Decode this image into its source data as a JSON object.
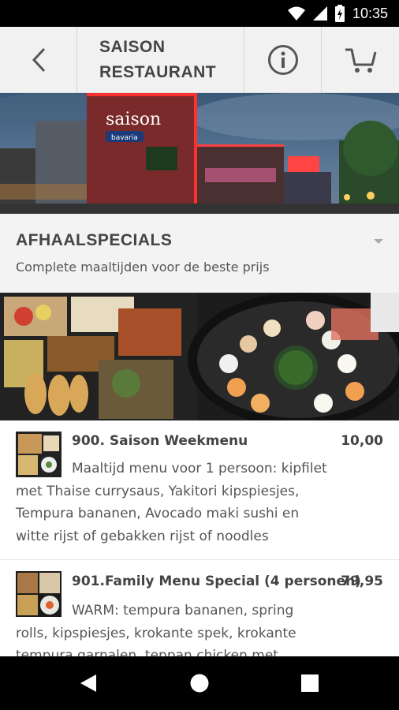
{
  "status_bar": {
    "time": "10:35",
    "icons": [
      "wifi-icon",
      "signal-icon",
      "battery-charging-icon"
    ]
  },
  "header": {
    "title_line1": "SAISON",
    "title_line2": "RESTAURANT",
    "icons": [
      "back-arrow-icon",
      "info-icon",
      "cart-icon"
    ]
  },
  "banner": {
    "sign_text": "saison",
    "sub_sign_text": "bavaria"
  },
  "category": {
    "title": "AFHAALSPECIALS",
    "subtitle": "Complete maaltijden voor de beste prijs"
  },
  "menu": {
    "items": [
      {
        "name": "900. Saison Weekmenu",
        "price": "10,00",
        "description_lines": [
          "Maaltijd menu voor 1 persoon: kipfilet",
          "met Thaise currysaus, Yakitori kipspiesjes,",
          "Tempura bananen, Avocado maki sushi en",
          "witte rijst of gebakken rijst of noodles"
        ]
      },
      {
        "name": "901.Family Menu Special (4 personen)",
        "price": "79,95",
        "description_lines": [
          "WARM: tempura bananen, spring",
          "rolls, kipspiesjes, krokante spek, krokante",
          "tempura garnalen, teppan chicken met"
        ]
      }
    ]
  },
  "colors": {
    "status_bar": "#000000",
    "header_bg": "#f1f1f1",
    "category_bg": "#f3f3f3",
    "text_dark": "#444444"
  }
}
